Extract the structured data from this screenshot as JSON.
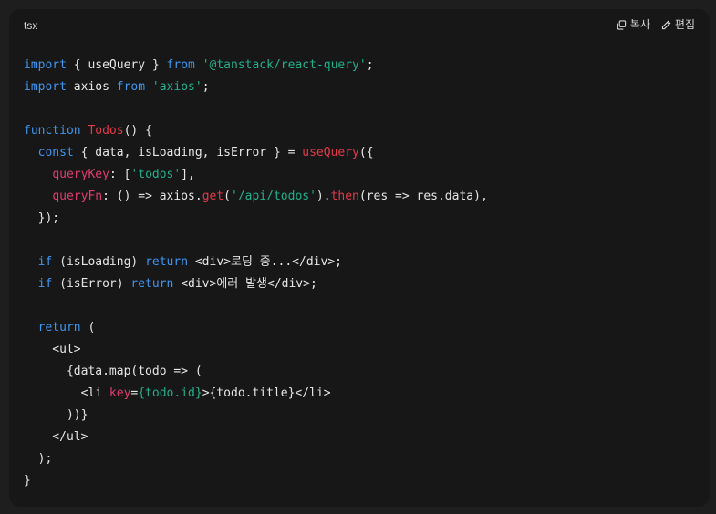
{
  "header": {
    "language": "tsx",
    "copy_label": "복사",
    "edit_label": "편집"
  },
  "colors": {
    "keyword": "#3e95ee",
    "function": "#e23a4b",
    "string": "#1fb18a",
    "property": "#e03c6f",
    "plain": "#e6e6e6",
    "background": "#171717"
  },
  "code": {
    "lines": [
      [
        {
          "t": "kw",
          "v": "import"
        },
        {
          "t": "pl",
          "v": " { useQuery } "
        },
        {
          "t": "kw",
          "v": "from"
        },
        {
          "t": "pl",
          "v": " "
        },
        {
          "t": "str",
          "v": "'@tanstack/react-query'"
        },
        {
          "t": "pl",
          "v": ";"
        }
      ],
      [
        {
          "t": "kw",
          "v": "import"
        },
        {
          "t": "pl",
          "v": " axios "
        },
        {
          "t": "kw",
          "v": "from"
        },
        {
          "t": "pl",
          "v": " "
        },
        {
          "t": "str",
          "v": "'axios'"
        },
        {
          "t": "pl",
          "v": ";"
        }
      ],
      [],
      [
        {
          "t": "kw",
          "v": "function"
        },
        {
          "t": "pl",
          "v": " "
        },
        {
          "t": "fn",
          "v": "Todos"
        },
        {
          "t": "pl",
          "v": "() {"
        }
      ],
      [
        {
          "t": "pl",
          "v": "  "
        },
        {
          "t": "kw",
          "v": "const"
        },
        {
          "t": "pl",
          "v": " { data, isLoading, isError } = "
        },
        {
          "t": "fn",
          "v": "useQuery"
        },
        {
          "t": "pl",
          "v": "({"
        }
      ],
      [
        {
          "t": "pl",
          "v": "    "
        },
        {
          "t": "prop",
          "v": "queryKey"
        },
        {
          "t": "pl",
          "v": ": ["
        },
        {
          "t": "str",
          "v": "'todos'"
        },
        {
          "t": "pl",
          "v": "],"
        }
      ],
      [
        {
          "t": "pl",
          "v": "    "
        },
        {
          "t": "prop",
          "v": "queryFn"
        },
        {
          "t": "pl",
          "v": ": () => axios."
        },
        {
          "t": "fn",
          "v": "get"
        },
        {
          "t": "pl",
          "v": "("
        },
        {
          "t": "str",
          "v": "'/api/todos'"
        },
        {
          "t": "pl",
          "v": ")."
        },
        {
          "t": "fn",
          "v": "then"
        },
        {
          "t": "pl",
          "v": "(res => res.data),"
        }
      ],
      [
        {
          "t": "pl",
          "v": "  });"
        }
      ],
      [],
      [
        {
          "t": "pl",
          "v": "  "
        },
        {
          "t": "kw",
          "v": "if"
        },
        {
          "t": "pl",
          "v": " (isLoading) "
        },
        {
          "t": "kw",
          "v": "return"
        },
        {
          "t": "pl",
          "v": " <div>로딩 중...</div>;"
        }
      ],
      [
        {
          "t": "pl",
          "v": "  "
        },
        {
          "t": "kw",
          "v": "if"
        },
        {
          "t": "pl",
          "v": " (isError) "
        },
        {
          "t": "kw",
          "v": "return"
        },
        {
          "t": "pl",
          "v": " <div>에러 발생</div>;"
        }
      ],
      [],
      [
        {
          "t": "pl",
          "v": "  "
        },
        {
          "t": "kw",
          "v": "return"
        },
        {
          "t": "pl",
          "v": " ("
        }
      ],
      [
        {
          "t": "pl",
          "v": "    <ul>"
        }
      ],
      [
        {
          "t": "pl",
          "v": "      {data.map(todo => ("
        }
      ],
      [
        {
          "t": "pl",
          "v": "        <li "
        },
        {
          "t": "attr",
          "v": "key"
        },
        {
          "t": "pl",
          "v": "="
        },
        {
          "t": "obj",
          "v": "{todo.id}"
        },
        {
          "t": "pl",
          "v": ">{todo.title}</li>"
        }
      ],
      [
        {
          "t": "pl",
          "v": "      ))}"
        }
      ],
      [
        {
          "t": "pl",
          "v": "    </ul>"
        }
      ],
      [
        {
          "t": "pl",
          "v": "  );"
        }
      ],
      [
        {
          "t": "pl",
          "v": "}"
        }
      ]
    ]
  }
}
